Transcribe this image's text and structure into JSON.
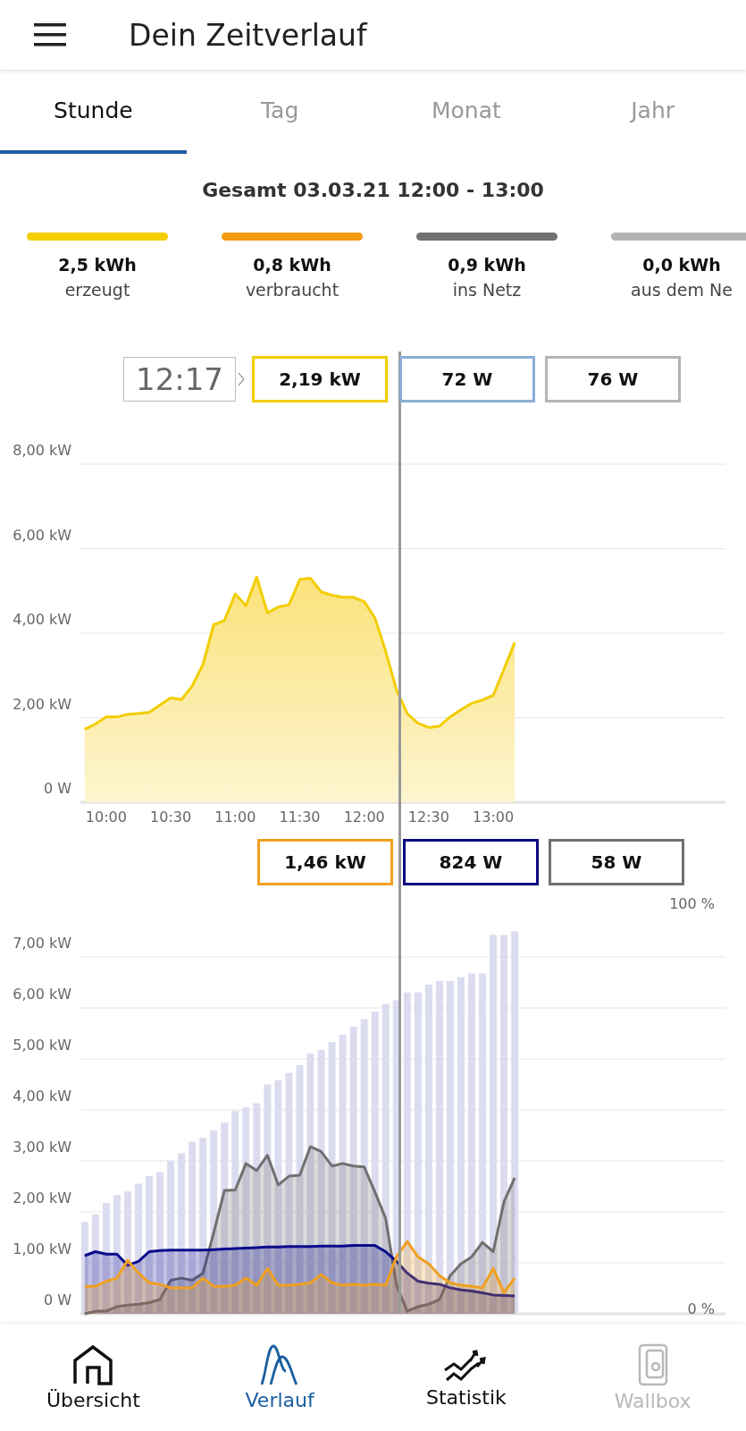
{
  "header": {
    "title": "Dein Zeitverlauf"
  },
  "tabs": [
    {
      "label": "Stunde",
      "selected": true
    },
    {
      "label": "Tag",
      "selected": false
    },
    {
      "label": "Monat",
      "selected": false
    },
    {
      "label": "Jahr",
      "selected": false
    }
  ],
  "summary": {
    "title": "Gesamt 03.03.21 12:00 - 13:00",
    "items": [
      {
        "value": "2,5 kWh",
        "label": "erzeugt",
        "color": "#f5cf00"
      },
      {
        "value": "0,8 kWh",
        "label": "verbraucht",
        "color": "#f39c12"
      },
      {
        "value": "0,9 kWh",
        "label": "ins Netz",
        "color": "#707070"
      },
      {
        "value": "0,0 kWh",
        "label": "aus dem Ne",
        "color": "#b4b4b4"
      }
    ]
  },
  "production_panel": {
    "time": "12:17",
    "readouts": [
      {
        "value": "2,19 kW",
        "color": "#f2cd00"
      },
      {
        "value": "72 W",
        "color": "#8aaed6"
      },
      {
        "value": "76 W",
        "color": "#b4b4b4"
      }
    ],
    "chart_data": {
      "type": "area",
      "x": [
        590,
        595,
        600,
        605,
        610,
        615,
        620,
        625,
        630,
        635,
        640,
        645,
        650,
        655,
        660,
        665,
        670,
        675,
        680,
        685,
        690,
        695,
        700,
        705,
        710,
        715,
        720,
        725,
        730,
        735,
        740,
        745,
        750,
        755,
        760,
        765,
        770,
        775,
        780,
        785,
        790
      ],
      "xlim": [
        588,
        888
      ],
      "grid": true,
      "xticks": [
        {
          "value": 600,
          "label": "10:00"
        },
        {
          "value": 630,
          "label": "10:30"
        },
        {
          "value": 660,
          "label": "11:00"
        },
        {
          "value": 690,
          "label": "11:30"
        },
        {
          "value": 720,
          "label": "12:00"
        },
        {
          "value": 750,
          "label": "12:30"
        },
        {
          "value": 780,
          "label": "13:00"
        }
      ],
      "ylim": [
        0,
        8
      ],
      "yticks": [
        {
          "value": 0,
          "label": "0 W"
        },
        {
          "value": 2,
          "label": "2,00 kW"
        },
        {
          "value": 4,
          "label": "4,00 kW"
        },
        {
          "value": 6,
          "label": "6,00 kW"
        },
        {
          "value": 8,
          "label": "8,00 kW"
        }
      ],
      "series": [
        {
          "color": "#f2cd00",
          "values": [
            1.73,
            1.85,
            2.02,
            2.02,
            2.08,
            2.1,
            2.13,
            2.3,
            2.47,
            2.43,
            2.75,
            3.26,
            4.2,
            4.3,
            4.93,
            4.65,
            5.33,
            4.48,
            4.62,
            4.67,
            5.27,
            5.3,
            4.98,
            4.9,
            4.85,
            4.85,
            4.75,
            4.36,
            3.57,
            2.66,
            2.1,
            1.87,
            1.77,
            1.8,
            2.02,
            2.19,
            2.34,
            2.42,
            2.53,
            3.15,
            3.78
          ]
        }
      ]
    }
  },
  "consumption_panel": {
    "readouts": [
      {
        "value": "1,46 kW",
        "color": "#f0a020"
      },
      {
        "value": "824 W",
        "color": "#0a0a80"
      },
      {
        "value": "58 W",
        "color": "#707070"
      }
    ],
    "chart_data": {
      "type": "bar",
      "x": [
        590,
        595,
        600,
        605,
        610,
        615,
        620,
        625,
        630,
        635,
        640,
        645,
        650,
        655,
        660,
        665,
        670,
        675,
        680,
        685,
        690,
        695,
        700,
        705,
        710,
        715,
        720,
        725,
        730,
        735,
        740,
        745,
        750,
        755,
        760,
        765,
        770,
        775,
        780,
        785,
        790
      ],
      "xlim": [
        588,
        888
      ],
      "ylim": [
        0,
        7
      ],
      "y2lim": [
        0,
        100
      ],
      "grid": true,
      "yticks": [
        {
          "value": 0,
          "label": "0 W"
        },
        {
          "value": 1,
          "label": "1,00 kW"
        },
        {
          "value": 2,
          "label": "2,00 kW"
        },
        {
          "value": 3,
          "label": "3,00 kW"
        },
        {
          "value": 4,
          "label": "4,00 kW"
        },
        {
          "value": 5,
          "label": "5,00 kW"
        },
        {
          "value": 6,
          "label": "6,00 kW"
        },
        {
          "value": 7,
          "label": "7,00 kW"
        }
      ],
      "y2ticks": [
        {
          "value": 0,
          "label": "0 %"
        },
        {
          "value": 100,
          "label": "100 %"
        }
      ],
      "series": [
        {
          "axis": "y2",
          "color": "#dcdcf0",
          "values": [
            22.4,
            24.2,
            27,
            28.9,
            29.8,
            31.7,
            33.6,
            34.5,
            37.3,
            39.1,
            41.9,
            42.9,
            44.7,
            46.6,
            49.4,
            50.3,
            51.3,
            55.9,
            56.9,
            58.7,
            60.6,
            63.4,
            64.3,
            66.2,
            68,
            69.9,
            71.8,
            73.6,
            75.5,
            76.4,
            78.3,
            78.3,
            80.2,
            81.1,
            81.1,
            82,
            82.9,
            82.9,
            92.3,
            92.3,
            93.2
          ]
        },
        {
          "type": "area",
          "color": "#707070",
          "values": [
            0,
            0.05,
            0.05,
            0.14,
            0.17,
            0.19,
            0.22,
            0.28,
            0.66,
            0.7,
            0.66,
            0.8,
            1.59,
            2.42,
            2.43,
            2.95,
            2.81,
            3.11,
            2.53,
            2.7,
            2.72,
            3.28,
            3.18,
            2.9,
            2.95,
            2.9,
            2.88,
            2.39,
            1.87,
            0.56,
            0.05,
            0.14,
            0.19,
            0.28,
            0.75,
            0.98,
            1.12,
            1.4,
            1.22,
            2.2,
            2.67
          ]
        },
        {
          "type": "area",
          "color": "#0a0a8c",
          "values": [
            1.14,
            1.22,
            1.17,
            1.17,
            0.95,
            1.03,
            1.22,
            1.24,
            1.25,
            1.25,
            1.25,
            1.25,
            1.26,
            1.27,
            1.28,
            1.29,
            1.3,
            1.31,
            1.31,
            1.32,
            1.32,
            1.32,
            1.33,
            1.33,
            1.33,
            1.34,
            1.34,
            1.34,
            1.22,
            1.03,
            0.8,
            0.64,
            0.6,
            0.58,
            0.51,
            0.47,
            0.45,
            0.41,
            0.37,
            0.36,
            0.35
          ]
        },
        {
          "type": "area",
          "color": "#f0a020",
          "values": [
            0.54,
            0.54,
            0.64,
            0.7,
            1.05,
            0.8,
            0.61,
            0.58,
            0.51,
            0.51,
            0.51,
            0.7,
            0.54,
            0.54,
            0.56,
            0.7,
            0.56,
            0.89,
            0.56,
            0.56,
            0.58,
            0.61,
            0.77,
            0.61,
            0.56,
            0.58,
            0.56,
            0.58,
            0.56,
            1.12,
            1.42,
            1.12,
            0.98,
            0.75,
            0.61,
            0.56,
            0.54,
            0.51,
            0.89,
            0.42,
            0.7
          ]
        }
      ]
    }
  },
  "nav": [
    {
      "label": "Übersicht",
      "selected": false,
      "disabled": false
    },
    {
      "label": "Verlauf",
      "selected": true,
      "disabled": false
    },
    {
      "label": "Statistik",
      "selected": false,
      "disabled": false
    },
    {
      "label": "Wallbox",
      "selected": false,
      "disabled": true
    }
  ]
}
